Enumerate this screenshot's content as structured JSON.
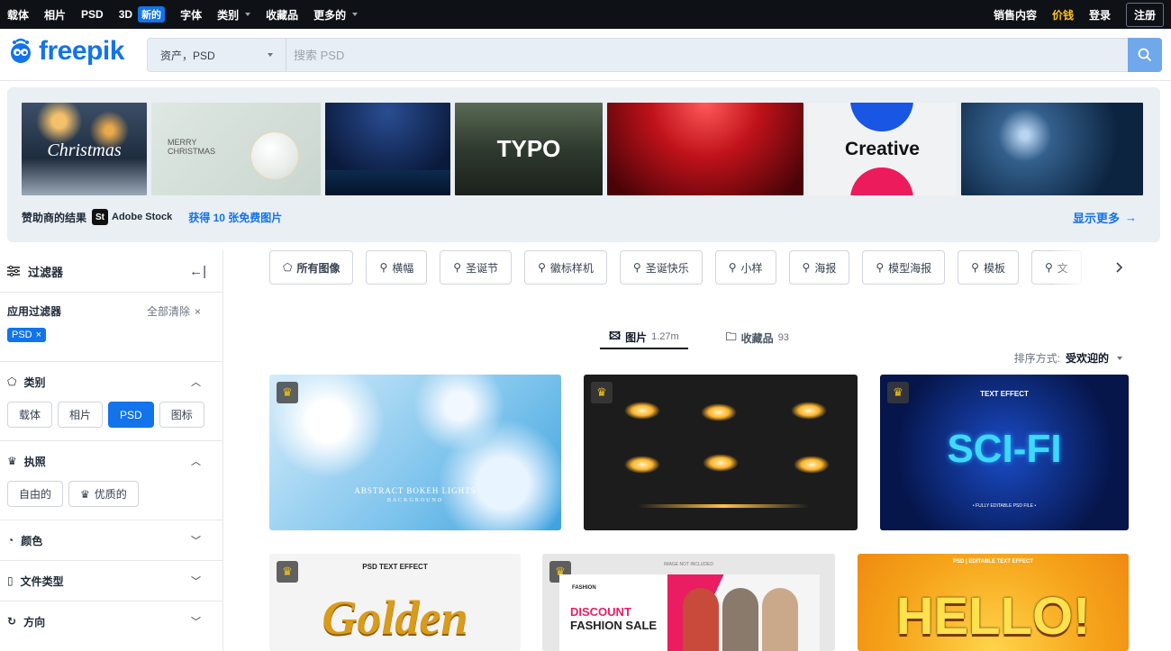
{
  "topbar": {
    "left": [
      {
        "label": "载体"
      },
      {
        "label": "相片"
      },
      {
        "label": "PSD"
      },
      {
        "label": "3D",
        "badge": "新的"
      },
      {
        "label": "字体"
      },
      {
        "label": "类别"
      },
      {
        "label": "收藏品"
      },
      {
        "label": "更多的"
      }
    ],
    "sell": "销售内容",
    "pricing": "价钱",
    "login": "登录",
    "register": "注册"
  },
  "header": {
    "logo": "freepik",
    "scope": "资产，PSD",
    "search_placeholder": "搜索 PSD"
  },
  "sponsor": {
    "results_label": "赞助商的结果",
    "stock_badge": "St",
    "stock_name": "Adobe Stock",
    "free_link": "获得 10 张免费图片",
    "show_more": "显示更多",
    "thumb_texts": {
      "christmas": "Christmas",
      "merry_christmas": "MERRY CHRISTMAS",
      "typo": "TYPO",
      "creative": "Creative"
    }
  },
  "sidebar": {
    "title": "过滤器",
    "applied_label": "应用过滤器",
    "clear_all": "全部清除",
    "applied_pill": "PSD",
    "sections": {
      "category": {
        "title": "类别",
        "chips": [
          "载体",
          "相片",
          "PSD",
          "图标"
        ],
        "active": "PSD"
      },
      "license": {
        "title": "执照",
        "chips": [
          "自由的",
          "优质的"
        ]
      },
      "color": {
        "title": "颜色"
      },
      "filetype": {
        "title": "文件类型"
      },
      "orientation": {
        "title": "方向"
      }
    }
  },
  "tags": [
    "所有图像",
    "横幅",
    "圣诞节",
    "徽标样机",
    "圣诞快乐",
    "小样",
    "海报",
    "模型海报",
    "模板",
    "文"
  ],
  "tabs": {
    "images": {
      "label": "图片",
      "count": "1.27m"
    },
    "collections": {
      "label": "收藏品",
      "count": "93"
    }
  },
  "sort": {
    "label": "排序方式:",
    "value": "受欢迎的"
  },
  "cards": {
    "bokeh": {
      "line1": "ABSTRACT BOKEH LIGHTS",
      "line2": "BACKGROUND"
    },
    "scifi": {
      "top": "TEXT EFFECT",
      "main": "SCI-FI",
      "bottom": "• FULLY EDITABLE PSD FILE •"
    },
    "golden": {
      "top": "PSD TEXT EFFECT",
      "main": "Golden"
    },
    "fashion": {
      "top": "IMAGE NOT INCLUDED",
      "brand": "FASHION",
      "l1": "DISCOUNT",
      "l2": "FASHION SALE"
    },
    "hello": {
      "top": "PSD | EDITABLE TEXT EFFECT",
      "main": "HELLO!"
    }
  },
  "colors": {
    "brand": "#1273eb",
    "topbar": "#0e1116",
    "price": "#fcc419"
  }
}
